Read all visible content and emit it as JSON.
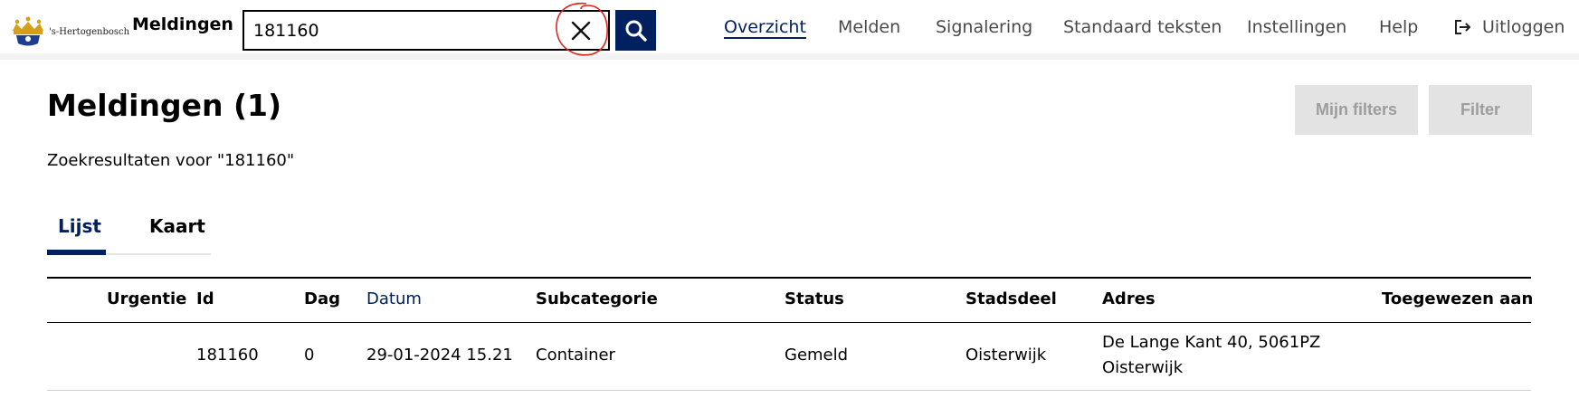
{
  "header": {
    "logo_text": "'s-Hertogenbosch",
    "app_title": "Meldingen",
    "search": {
      "value": "181160",
      "clear_icon": "close-icon",
      "search_icon": "search-icon"
    },
    "nav": [
      {
        "label": "Overzicht",
        "active": true
      },
      {
        "label": "Melden"
      },
      {
        "label": "Signalering"
      },
      {
        "label": "Standaard teksten"
      },
      {
        "label": "Instellingen"
      },
      {
        "label": "Help"
      }
    ],
    "logout_label": "Uitloggen",
    "annotation_color": "#e0231c"
  },
  "main": {
    "title": "Meldingen (1)",
    "buttons": {
      "my_filters": "Mijn filters",
      "filter": "Filter"
    },
    "search_result_prefix": "Zoekresultaten voor",
    "search_result_query": "181160",
    "tabs": [
      {
        "label": "Lijst",
        "active": true
      },
      {
        "label": "Kaart"
      }
    ],
    "table": {
      "columns": [
        "Urgentie",
        "Id",
        "Dag",
        "Datum",
        "Subcategorie",
        "Status",
        "Stadsdeel",
        "Adres",
        "Toegewezen aan"
      ],
      "rows": [
        {
          "urgentie": "",
          "id": "181160",
          "dag": "0",
          "datum": "29-01-2024 15.21",
          "subcategorie": "Container",
          "status": "Gemeld",
          "stadsdeel": "Oisterwijk",
          "adres_line1": "De Lange Kant 40, 5061PZ",
          "adres_line2": "Oisterwijk",
          "toegewezen_aan": ""
        }
      ]
    }
  },
  "colors": {
    "primary": "#002060",
    "disabled_bg": "#e3e3e3",
    "disabled_text": "#9d9d9d"
  }
}
